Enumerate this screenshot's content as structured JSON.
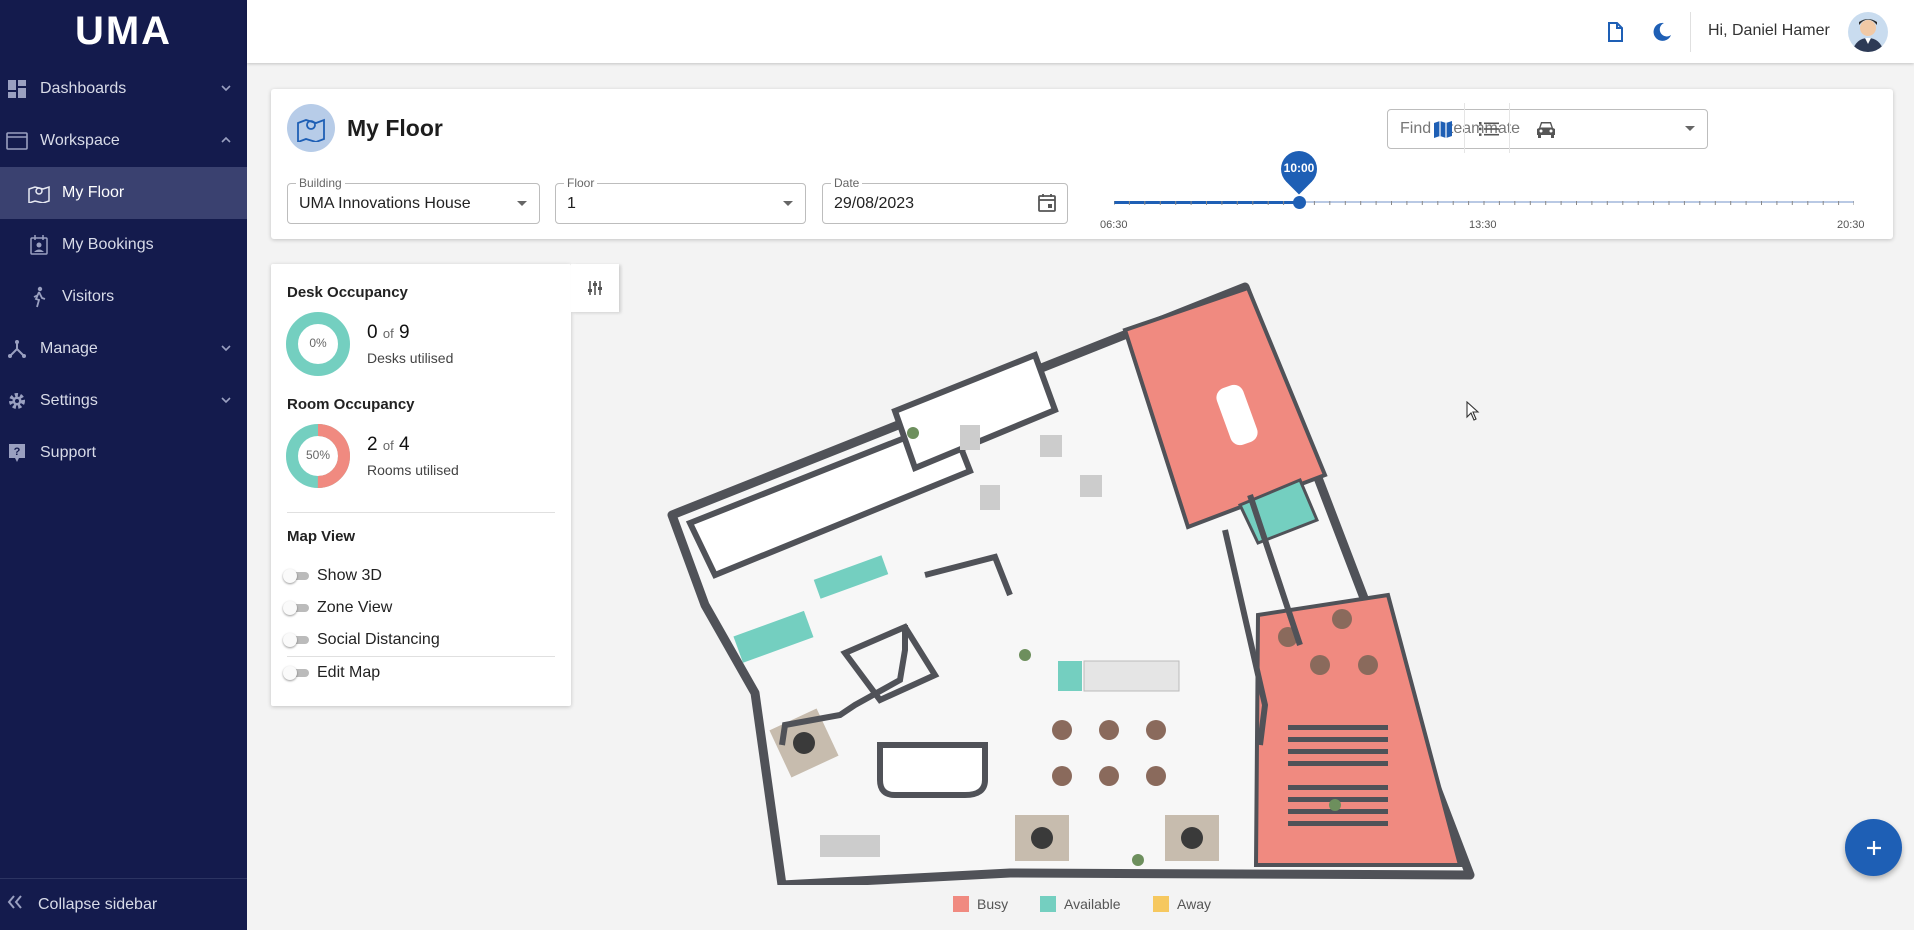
{
  "app": {
    "logo": "UMA"
  },
  "sidebar": {
    "items": [
      {
        "label": "Dashboards"
      },
      {
        "label": "Workspace"
      },
      {
        "label": "My Floor"
      },
      {
        "label": "My Bookings"
      },
      {
        "label": "Visitors"
      },
      {
        "label": "Manage"
      },
      {
        "label": "Settings"
      },
      {
        "label": "Support"
      }
    ],
    "collapse_label": "Collapse sidebar"
  },
  "topbar": {
    "greeting": "Hi, Daniel Hamer"
  },
  "header": {
    "title": "My Floor",
    "find_placeholder": "Find a teammate",
    "building": {
      "label": "Building",
      "value": "UMA Innovations House"
    },
    "floor": {
      "label": "Floor",
      "value": "1"
    },
    "date": {
      "label": "Date",
      "value": "29/08/2023"
    },
    "time": {
      "current": "10:00",
      "start": "06:30",
      "middle": "13:30",
      "end": "20:30",
      "fraction": 0.25
    }
  },
  "occupancy": {
    "desk": {
      "title": "Desk Occupancy",
      "percent_label": "0%",
      "used": "0",
      "of": "of",
      "total": "9",
      "caption": "Desks utilised",
      "fraction": 0
    },
    "room": {
      "title": "Room Occupancy",
      "percent_label": "50%",
      "used": "2",
      "of": "of",
      "total": "4",
      "caption": "Rooms utilised",
      "fraction": 0.5
    }
  },
  "map_view": {
    "title": "Map View",
    "toggles": [
      {
        "label": "Show 3D"
      },
      {
        "label": "Zone View"
      },
      {
        "label": "Social Distancing"
      },
      {
        "label": "Edit Map"
      }
    ]
  },
  "legend": [
    {
      "label": "Busy",
      "color": "#f08a80"
    },
    {
      "label": "Available",
      "color": "#74cfc0"
    },
    {
      "label": "Away",
      "color": "#f6c85f"
    }
  ],
  "colors": {
    "primary": "#1e5fb5",
    "sidebar": "#141b4d",
    "busy": "#f08a80",
    "available": "#74cfc0"
  }
}
